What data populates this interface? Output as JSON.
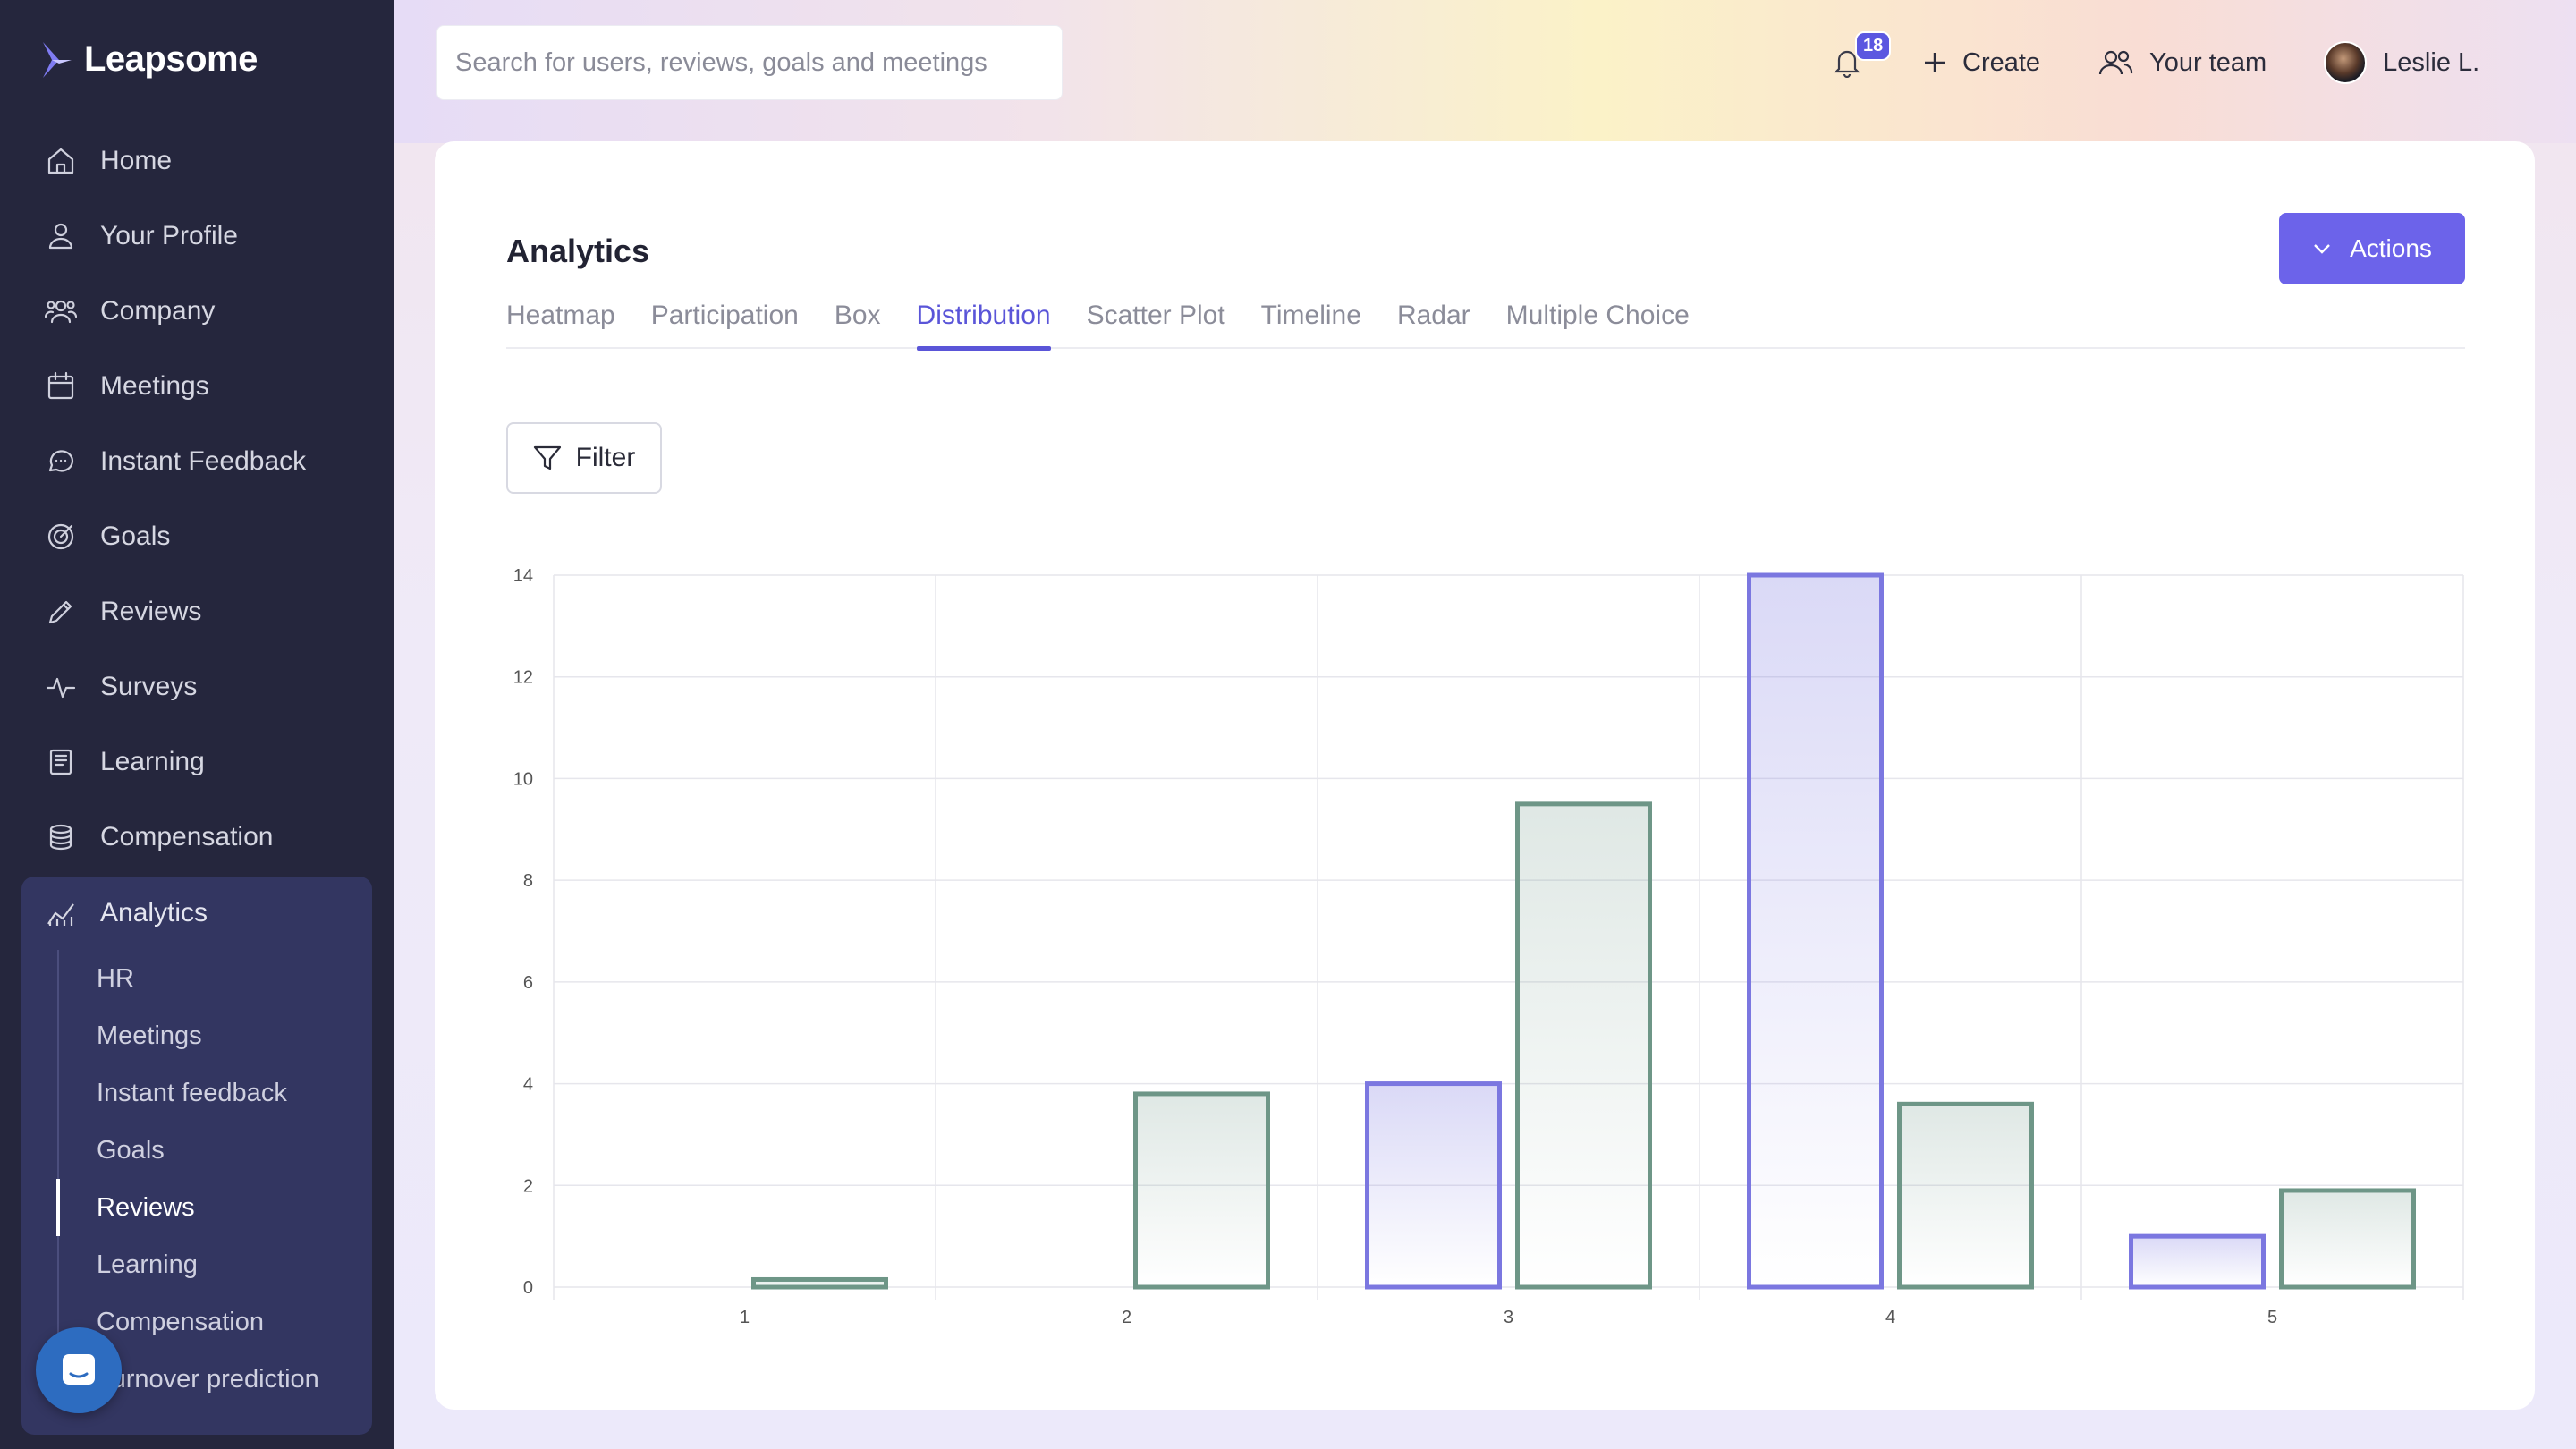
{
  "app": {
    "brand": "Leapsome"
  },
  "sidebar": {
    "items": [
      {
        "label": "Home",
        "icon": "home-icon"
      },
      {
        "label": "Your Profile",
        "icon": "user-icon"
      },
      {
        "label": "Company",
        "icon": "users-icon"
      },
      {
        "label": "Meetings",
        "icon": "calendar-icon"
      },
      {
        "label": "Instant Feedback",
        "icon": "chat-icon"
      },
      {
        "label": "Goals",
        "icon": "target-icon"
      },
      {
        "label": "Reviews",
        "icon": "pencil-icon"
      },
      {
        "label": "Surveys",
        "icon": "pulse-icon"
      },
      {
        "label": "Learning",
        "icon": "book-icon"
      },
      {
        "label": "Compensation",
        "icon": "coins-icon"
      }
    ],
    "analytics": {
      "label": "Analytics",
      "icon": "analytics-icon",
      "subitems": [
        "HR",
        "Meetings",
        "Instant feedback",
        "Goals",
        "Reviews",
        "Learning",
        "Compensation",
        "Turnover prediction"
      ],
      "active": "Reviews"
    }
  },
  "topbar": {
    "search_placeholder": "Search for users, reviews, goals and meetings",
    "notifications_count": "18",
    "create_label": "Create",
    "team_label": "Your team",
    "user_name": "Leslie L."
  },
  "page": {
    "title": "Analytics",
    "actions_label": "Actions",
    "tabs": [
      "Heatmap",
      "Participation",
      "Box",
      "Distribution",
      "Scatter Plot",
      "Timeline",
      "Radar",
      "Multiple Choice"
    ],
    "active_tab": "Distribution",
    "filter_label": "Filter"
  },
  "colors": {
    "accent": "#5a55d8",
    "series_a": "#7b77e0",
    "series_b": "#6e9687"
  },
  "chart_data": {
    "type": "bar",
    "categories": [
      "1",
      "2",
      "3",
      "4",
      "5"
    ],
    "series": [
      {
        "values": [
          0,
          0,
          4,
          14,
          1
        ]
      },
      {
        "values": [
          0.15,
          3.8,
          9.5,
          3.6,
          1.9
        ]
      }
    ],
    "yticks": [
      "0",
      "2",
      "4",
      "6",
      "8",
      "10",
      "12",
      "14"
    ],
    "ylim": [
      0,
      14
    ],
    "grid": true
  }
}
